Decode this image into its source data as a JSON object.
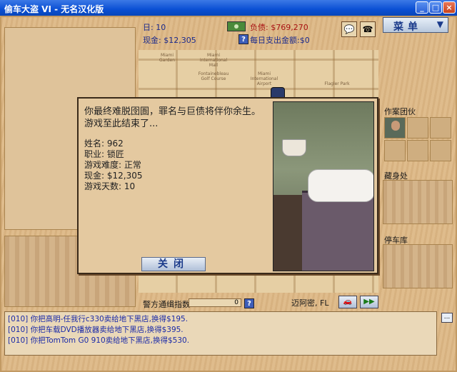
{
  "window": {
    "title": "偷车大盗 VI - 无名汉化版"
  },
  "stats": {
    "day": "日: 10",
    "debt": "负债: $769,270",
    "cash": "现金: $12,305",
    "daily_expense": "每日支出金额:$0",
    "help": "?"
  },
  "menu": {
    "label": "菜单",
    "caret": "▼"
  },
  "map_labels": [
    "Miami Garden",
    "Miami International Mall",
    "Fontainebleau Golf Course",
    "Miami International Airport",
    "Flagler Park"
  ],
  "dialog": {
    "message": "你最终难脱囹圄，罪名与巨债将伴你余生。游戏至此结束了...",
    "info": [
      "姓名: 962",
      "职业: 锁匠",
      "游戏难度: 正常",
      "现金: $12,305",
      "游戏天数: 10"
    ],
    "close_label": "关闭"
  },
  "sidebar": {
    "crew_label": "作案团伙",
    "hideout_label": "藏身处",
    "garage_label": "停车库"
  },
  "bottom": {
    "wanted_label": "警方通缉指数",
    "wanted_value": "0",
    "wanted_level": 0,
    "help": "?",
    "city": "迈阿密, FL"
  },
  "log": [
    "[010] 你把高明-任我行c330卖给地下黑店,换得$195.",
    "[010] 你把车载DVD播放器卖给地下黑店,换得$395.",
    "[010] 你把TomTom G0 910卖给地下黑店,换得$530."
  ],
  "log_more": "..."
}
